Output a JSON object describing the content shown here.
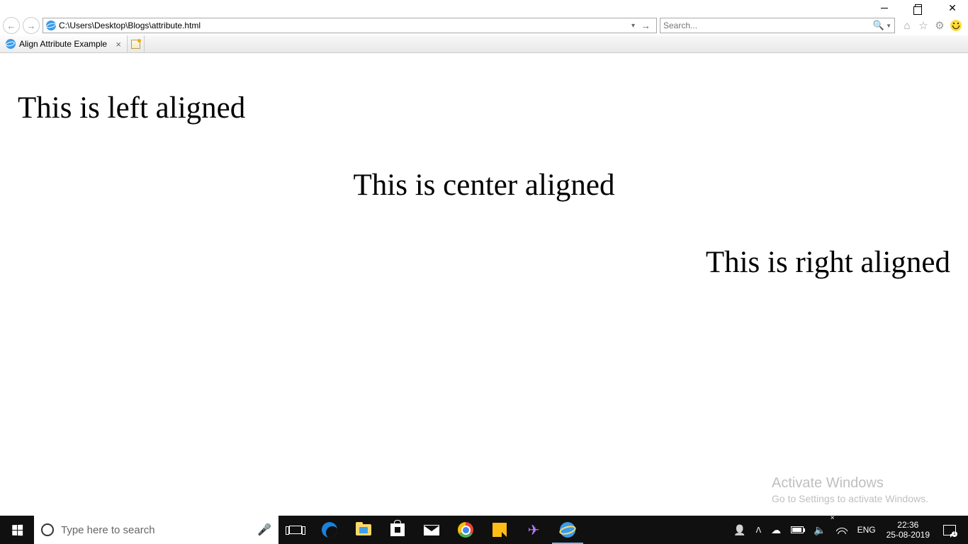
{
  "titlebar": {
    "minimize": "—",
    "maximize": "❐",
    "close": "✕"
  },
  "navbar": {
    "back": "←",
    "forward": "→",
    "url": "C:\\Users\\Desktop\\Blogs\\attribute.html",
    "refresh_go": "→",
    "search_placeholder": "Search..."
  },
  "tabs": {
    "active_title": "Align Attribute Example"
  },
  "content": {
    "left_text": "This is left aligned",
    "center_text": "This is center aligned",
    "right_text": "This is right aligned"
  },
  "watermark": {
    "title": "Activate Windows",
    "subtitle": "Go to Settings to activate Windows."
  },
  "taskbar": {
    "search_placeholder": "Type here to search",
    "language": "ENG",
    "time": "22:36",
    "date": "25-08-2019",
    "notification_count": "1"
  }
}
